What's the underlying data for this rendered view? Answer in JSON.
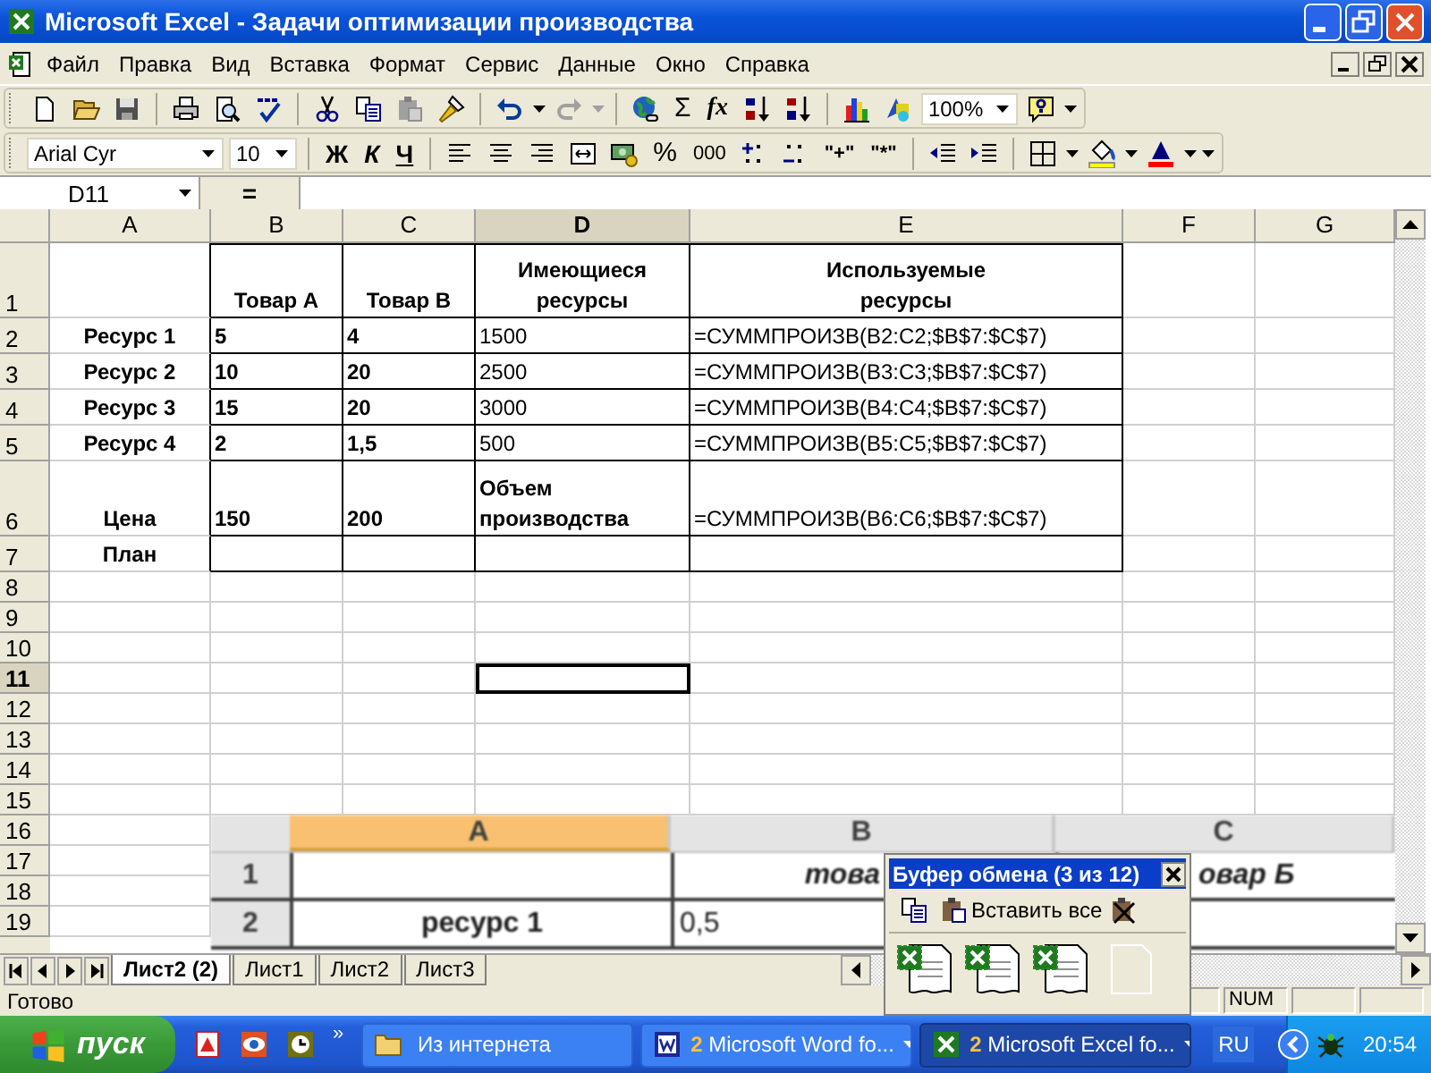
{
  "window": {
    "title": "Microsoft Excel - Задачи оптимизации производства"
  },
  "menu": [
    "Файл",
    "Правка",
    "Вид",
    "Вставка",
    "Формат",
    "Сервис",
    "Данные",
    "Окно",
    "Справка"
  ],
  "standard_toolbar": {
    "sum": "Σ",
    "function": "fx",
    "zoom": "100%"
  },
  "format_toolbar": {
    "font": "Arial Cyr",
    "size": "10",
    "bold": "Ж",
    "italic": "К",
    "underline": "Ч",
    "percent": "%",
    "thousands": "000",
    "text_plus": "\"+\"",
    "text_star": "\"*\""
  },
  "formula_bar": {
    "name_box": "D11",
    "equals": "="
  },
  "columns": [
    {
      "label": "A",
      "selected": false
    },
    {
      "label": "B",
      "selected": false
    },
    {
      "label": "C",
      "selected": false
    },
    {
      "label": "D",
      "selected": true
    },
    {
      "label": "E",
      "selected": false
    },
    {
      "label": "F",
      "selected": false
    },
    {
      "label": "G",
      "selected": false
    }
  ],
  "rows": [
    {
      "number": "1",
      "selected": false,
      "kind": "tall",
      "cells": [
        {},
        {
          "text": "Товар А",
          "bold": true
        },
        {
          "text": "Товар В",
          "bold": true
        },
        {
          "text": "Имеющиеся\nресурсы",
          "bold": true
        },
        {
          "text": "Используемые\nресурсы",
          "bold": true
        },
        {},
        {}
      ]
    },
    {
      "number": "2",
      "selected": false,
      "kind": "table",
      "cells": [
        {
          "text": "Ресурс 1",
          "bold": true
        },
        {
          "text": "5",
          "bold": true
        },
        {
          "text": "4",
          "bold": true
        },
        {
          "text": "1500",
          "bold": false
        },
        {
          "text": "=СУММПРОИЗВ(B2:C2;$B$7:$C$7)",
          "bold": false
        },
        {},
        {}
      ]
    },
    {
      "number": "3",
      "selected": false,
      "kind": "table",
      "cells": [
        {
          "text": "Ресурс 2",
          "bold": true
        },
        {
          "text": "10",
          "bold": true
        },
        {
          "text": "20",
          "bold": true
        },
        {
          "text": "2500",
          "bold": false
        },
        {
          "text": "=СУММПРОИЗВ(B3:C3;$B$7:$C$7)",
          "bold": false
        },
        {},
        {}
      ]
    },
    {
      "number": "4",
      "selected": false,
      "kind": "table",
      "cells": [
        {
          "text": "Ресурс 3",
          "bold": true
        },
        {
          "text": "15",
          "bold": true
        },
        {
          "text": "20",
          "bold": true
        },
        {
          "text": "3000",
          "bold": false
        },
        {
          "text": "=СУММПРОИЗВ(B4:C4;$B$7:$C$7)",
          "bold": false
        },
        {},
        {}
      ]
    },
    {
      "number": "5",
      "selected": false,
      "kind": "table",
      "cells": [
        {
          "text": "Ресурс 4",
          "bold": true
        },
        {
          "text": "2",
          "bold": true
        },
        {
          "text": "1,5",
          "bold": true
        },
        {
          "text": "500",
          "bold": false
        },
        {
          "text": "=СУММПРОИЗВ(B5:C5;$B$7:$C$7)",
          "bold": false
        },
        {},
        {}
      ]
    },
    {
      "number": "6",
      "selected": false,
      "kind": "tall",
      "cells": [
        {
          "text": "Цена",
          "bold": true
        },
        {
          "text": "150",
          "bold": true
        },
        {
          "text": "200",
          "bold": true
        },
        {
          "text": "Объем\n производства",
          "bold": true
        },
        {
          "text": "=СУММПРОИЗВ(B6:C6;$B$7:$C$7)",
          "bold": false
        },
        {},
        {}
      ]
    },
    {
      "number": "7",
      "selected": false,
      "kind": "table",
      "cells": [
        {
          "text": "План",
          "bold": true
        },
        {},
        {},
        {},
        {},
        {},
        {}
      ]
    },
    {
      "number": "8",
      "selected": false,
      "kind": "blank"
    },
    {
      "number": "9",
      "selected": false,
      "kind": "blank"
    },
    {
      "number": "10",
      "selected": false,
      "kind": "blank"
    },
    {
      "number": "11",
      "selected": true,
      "kind": "blank"
    },
    {
      "number": "12",
      "selected": false,
      "kind": "blank"
    },
    {
      "number": "13",
      "selected": false,
      "kind": "blank"
    },
    {
      "number": "14",
      "selected": false,
      "kind": "blank"
    },
    {
      "number": "15",
      "selected": false,
      "kind": "blank"
    },
    {
      "number": "16",
      "selected": false,
      "kind": "blank"
    },
    {
      "number": "17",
      "selected": false,
      "kind": "blank"
    },
    {
      "number": "18",
      "selected": false,
      "kind": "blank"
    },
    {
      "number": "19",
      "selected": false,
      "kind": "blank"
    }
  ],
  "embedded_screenshot": {
    "columns": [
      {
        "label": "A",
        "selected": true
      },
      {
        "label": "B",
        "selected": false
      },
      {
        "label": "C",
        "selected": false
      }
    ],
    "rows": [
      {
        "number": "1",
        "cells": [
          "",
          "това",
          "овар Б"
        ]
      },
      {
        "number": "2",
        "cells": [
          "ресурс 1",
          "0,5",
          ""
        ]
      }
    ]
  },
  "sheet_tabs": [
    {
      "label": "Лист2 (2)",
      "selected": true
    },
    {
      "label": "Лист1",
      "selected": false
    },
    {
      "label": "Лист2",
      "selected": false
    },
    {
      "label": "Лист3",
      "selected": false
    }
  ],
  "status_bar": {
    "text": "Готово",
    "num": "NUM"
  },
  "clipboard": {
    "title": "Буфер обмена (3 из 12)",
    "paste_all": "Вставить все",
    "items": [
      {
        "kind": "excel"
      },
      {
        "kind": "excel"
      },
      {
        "kind": "excel"
      },
      {
        "kind": "empty"
      }
    ]
  },
  "taskbar": {
    "start": "пуск",
    "more": "»",
    "tasks": [
      {
        "label": "Из интернета",
        "kind": "folder",
        "selected": false
      },
      {
        "count": "2",
        "label": "Microsoft Word fo...",
        "kind": "word",
        "selected": false
      },
      {
        "count": "2",
        "label": "Microsoft Excel fo...",
        "kind": "excel",
        "selected": true
      }
    ],
    "language": "RU",
    "time": "20:54"
  }
}
